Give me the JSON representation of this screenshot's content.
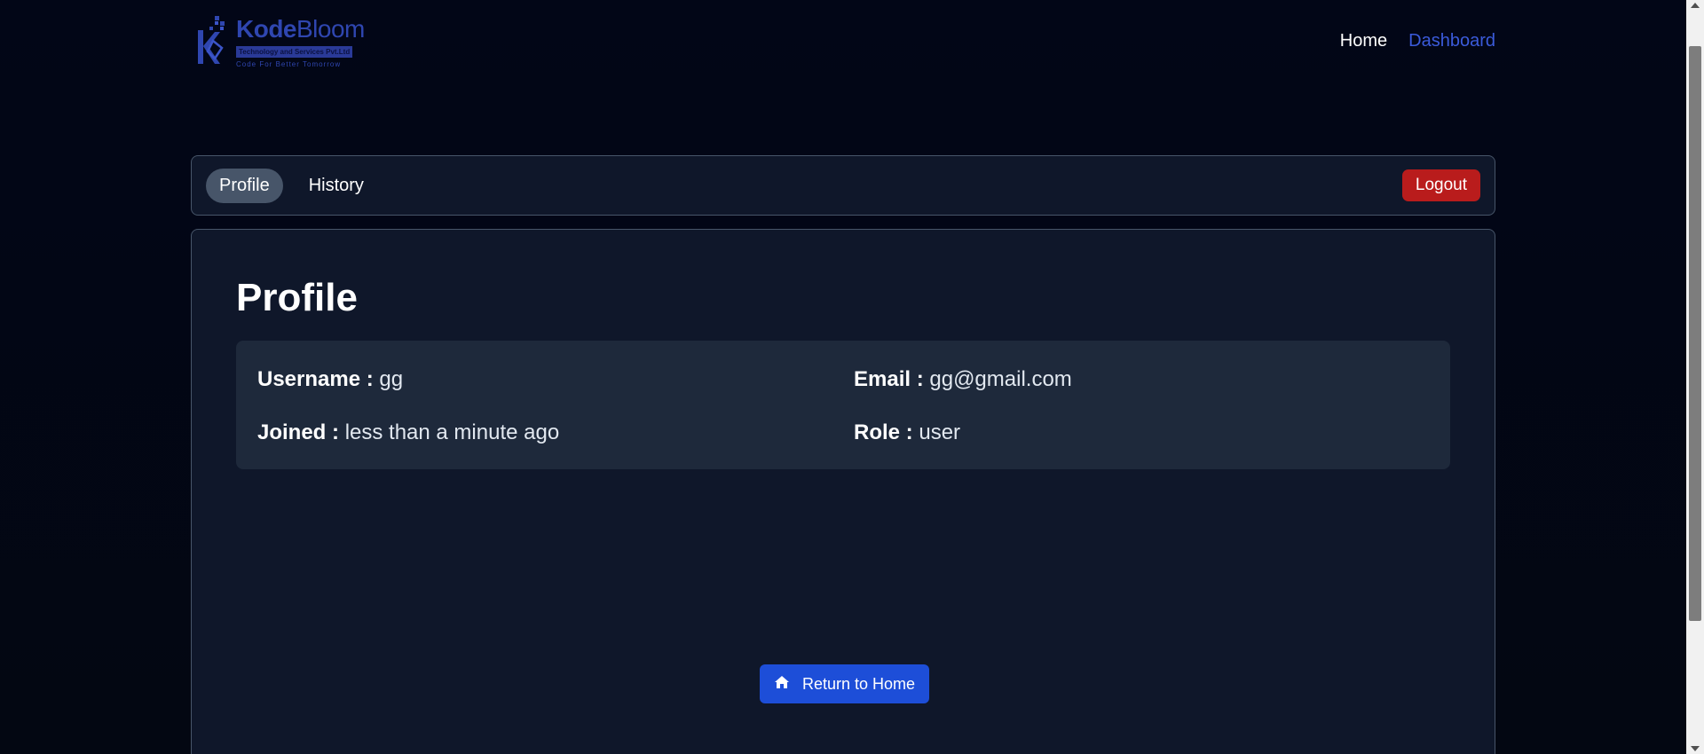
{
  "header": {
    "logo": {
      "name_bold": "Kode",
      "name_regular": "Bloom",
      "subtitle": "Technology and Services Pvt.Ltd",
      "tagline": "Code For Better Tomorrow"
    },
    "nav": [
      {
        "label": "Home"
      },
      {
        "label": "Dashboard"
      }
    ]
  },
  "tabs": [
    {
      "label": "Profile",
      "active": true
    },
    {
      "label": "History",
      "active": false
    }
  ],
  "logout_label": "Logout",
  "profile": {
    "title": "Profile",
    "username_label": "Username :",
    "username_value": "gg",
    "email_label": "Email :",
    "email_value": "gg@gmail.com",
    "joined_label": "Joined :",
    "joined_value": "less than a minute ago",
    "role_label": "Role :",
    "role_value": "user"
  },
  "return_button": {
    "label": "Return to Home",
    "icon": "home-icon"
  },
  "colors": {
    "background": "#030712",
    "panel": "#0f172a",
    "card": "#1e293b",
    "accent": "#1d4ed8",
    "danger": "#b91c1c",
    "nav_active": "#3b5bdb"
  }
}
